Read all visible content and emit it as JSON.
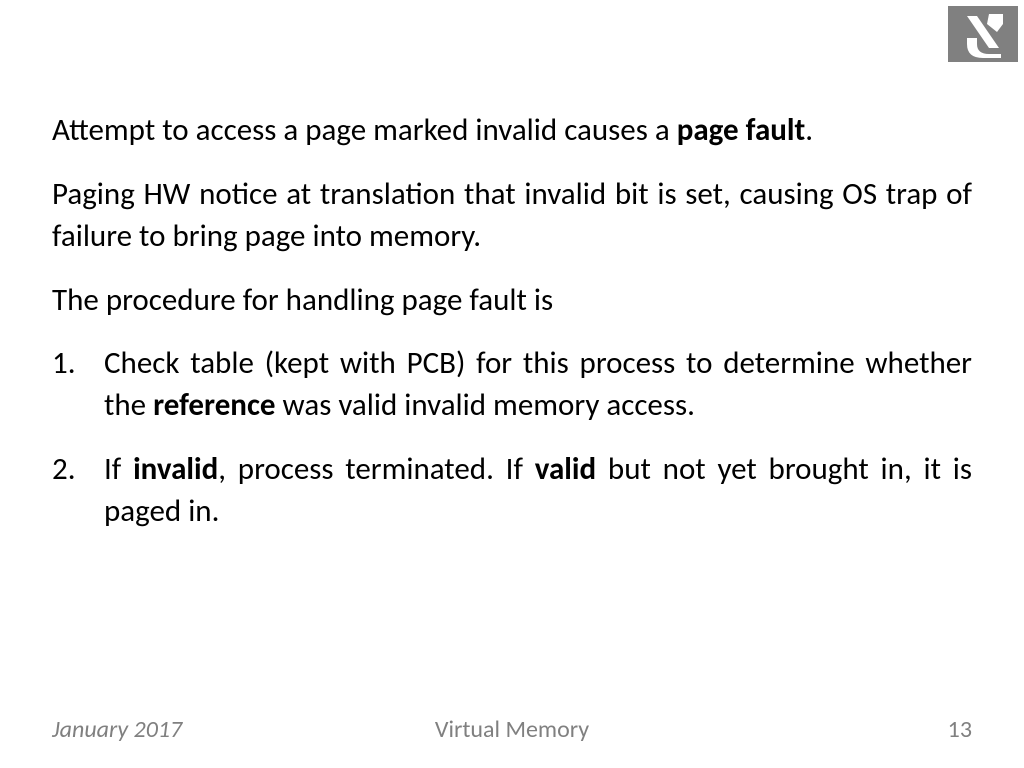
{
  "paragraphs": {
    "p1_prefix": "Attempt to access a page marked invalid causes a ",
    "p1_bold": "page fault",
    "p1_suffix": ".",
    "p2": "Paging HW notice at translation that invalid bit is set, causing OS trap of failure to bring page into memory.",
    "p3": "The procedure for handling page fault is"
  },
  "list": {
    "item1": {
      "num": "1.",
      "a": "Check table (kept with PCB) for this process to determine whether the ",
      "b_bold": "reference",
      "c": " was valid invalid memory access."
    },
    "item2": {
      "num": "2.",
      "a": "If ",
      "b_bold": "invalid",
      "c": ", process terminated. If ",
      "d_bold": "valid",
      "e": " but not yet brought in, it is paged in."
    }
  },
  "footer": {
    "date": "January 2017",
    "title": "Virtual Memory",
    "page": "13"
  }
}
